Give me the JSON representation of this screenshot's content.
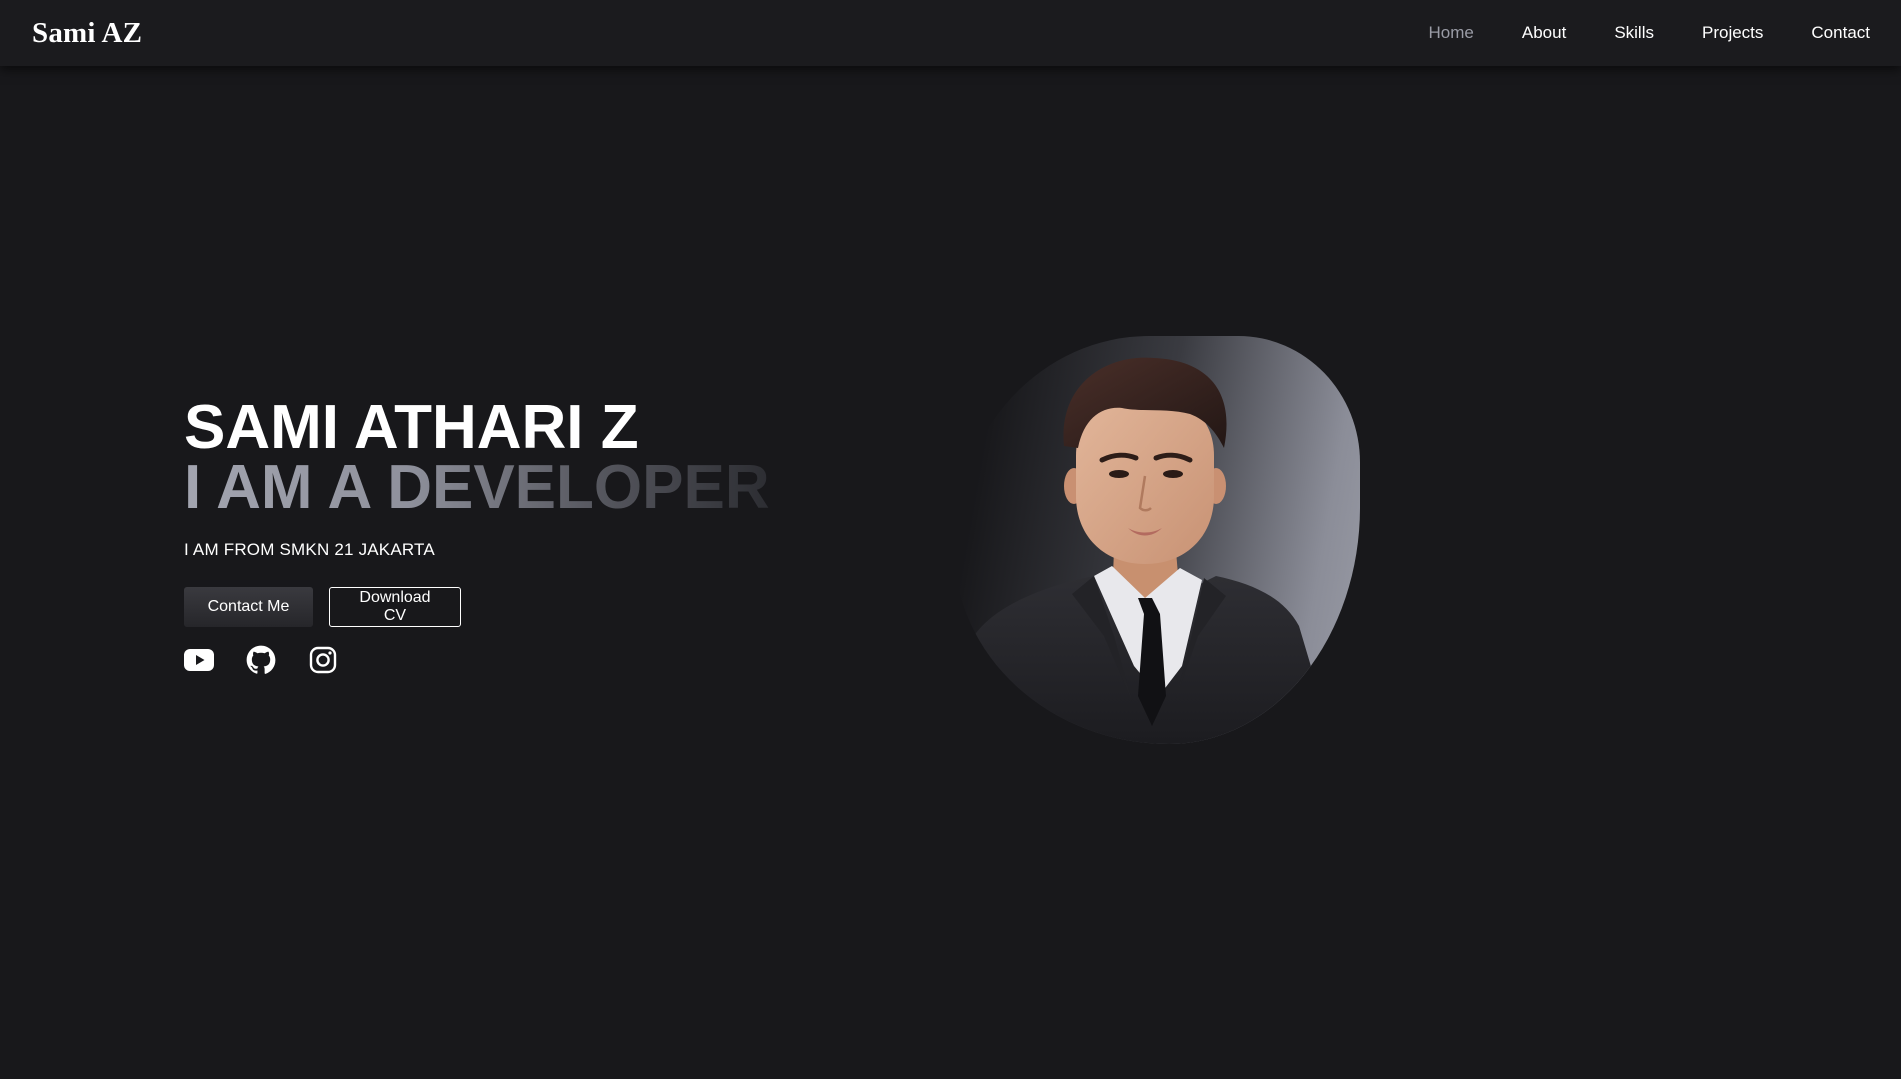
{
  "brand": {
    "logo": "Sami AZ"
  },
  "nav": {
    "items": [
      {
        "label": "Home",
        "active": true
      },
      {
        "label": "About"
      },
      {
        "label": "Skills"
      },
      {
        "label": "Projects"
      },
      {
        "label": "Contact"
      }
    ]
  },
  "hero": {
    "name": "SAMI ATHARI Z",
    "role": "I AM A DEVELOPER",
    "from": "I AM FROM SMKN 21 JAKARTA",
    "contact_button": "Contact Me",
    "cv_button": "Download CV",
    "socials": [
      {
        "icon": "youtube-icon"
      },
      {
        "icon": "github-icon"
      },
      {
        "icon": "instagram-icon"
      }
    ]
  },
  "colors": {
    "background": "#18181b",
    "navbar": "#1b1b1e",
    "active_nav": "#9a9ca6",
    "text": "#ffffff"
  }
}
